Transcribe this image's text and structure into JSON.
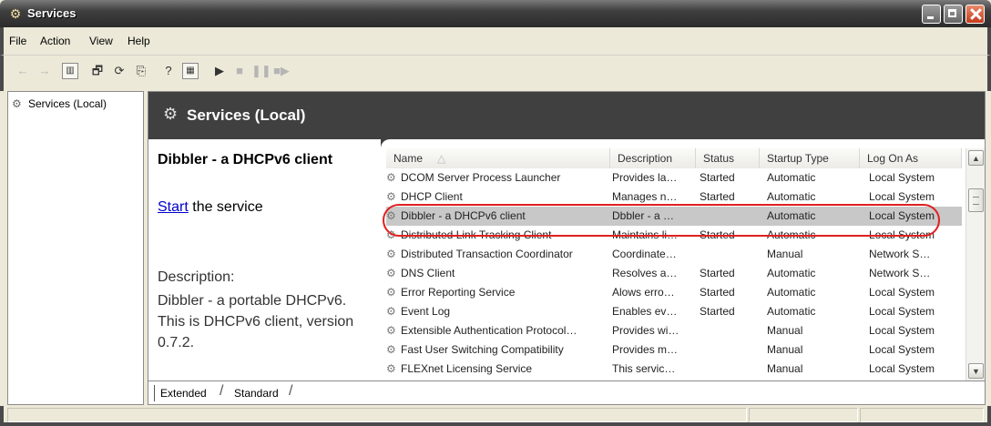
{
  "window": {
    "title": "Services"
  },
  "menu": [
    "File",
    "Action",
    "View",
    "Help"
  ],
  "tree": {
    "root_label": "Services (Local)"
  },
  "header": {
    "title": "Services (Local)"
  },
  "details": {
    "service_name": "Dibbler - a DHCPv6 client",
    "start_link": "Start",
    "start_suffix": " the service",
    "description_label": "Description:",
    "description_text": "Dibbler - a portable DHCPv6. This is DHCPv6 client, version 0.7.2."
  },
  "columns": {
    "name": "Name",
    "description": "Description",
    "status": "Status",
    "startup": "Startup Type",
    "logon": "Log On As"
  },
  "rows": [
    {
      "name": "DCOM Server Process Launcher",
      "desc": "Provides la…",
      "status": "Started",
      "startup": "Automatic",
      "logon": "Local System"
    },
    {
      "name": "DHCP Client",
      "desc": "Manages n…",
      "status": "Started",
      "startup": "Automatic",
      "logon": "Local System"
    },
    {
      "name": "Dibbler - a DHCPv6 client",
      "desc": "Dbbler - a …",
      "status": "",
      "startup": "Automatic",
      "logon": "Local System"
    },
    {
      "name": "Distributed Link Tracking Client",
      "desc": "Maintains li…",
      "status": "Started",
      "startup": "Automatic",
      "logon": "Local System"
    },
    {
      "name": "Distributed Transaction Coordinator",
      "desc": "Coordinate…",
      "status": "",
      "startup": "Manual",
      "logon": "Network S…"
    },
    {
      "name": "DNS Client",
      "desc": "Resolves a…",
      "status": "Started",
      "startup": "Automatic",
      "logon": "Network S…"
    },
    {
      "name": "Error Reporting Service",
      "desc": "Alows erro…",
      "status": "Started",
      "startup": "Automatic",
      "logon": "Local System"
    },
    {
      "name": "Event Log",
      "desc": "Enables ev…",
      "status": "Started",
      "startup": "Automatic",
      "logon": "Local System"
    },
    {
      "name": "Extensible Authentication Protocol…",
      "desc": "Provides wi…",
      "status": "",
      "startup": "Manual",
      "logon": "Local System"
    },
    {
      "name": "Fast User Switching Compatibility",
      "desc": "Provides m…",
      "status": "",
      "startup": "Manual",
      "logon": "Local System"
    },
    {
      "name": "FLEXnet Licensing Service",
      "desc": "This servic…",
      "status": "",
      "startup": "Manual",
      "logon": "Local System"
    }
  ],
  "tabs": [
    "Extended",
    "Standard"
  ],
  "colors": {
    "highlight": "#e02020",
    "header_band": "#404040",
    "link": "#0000cc"
  }
}
